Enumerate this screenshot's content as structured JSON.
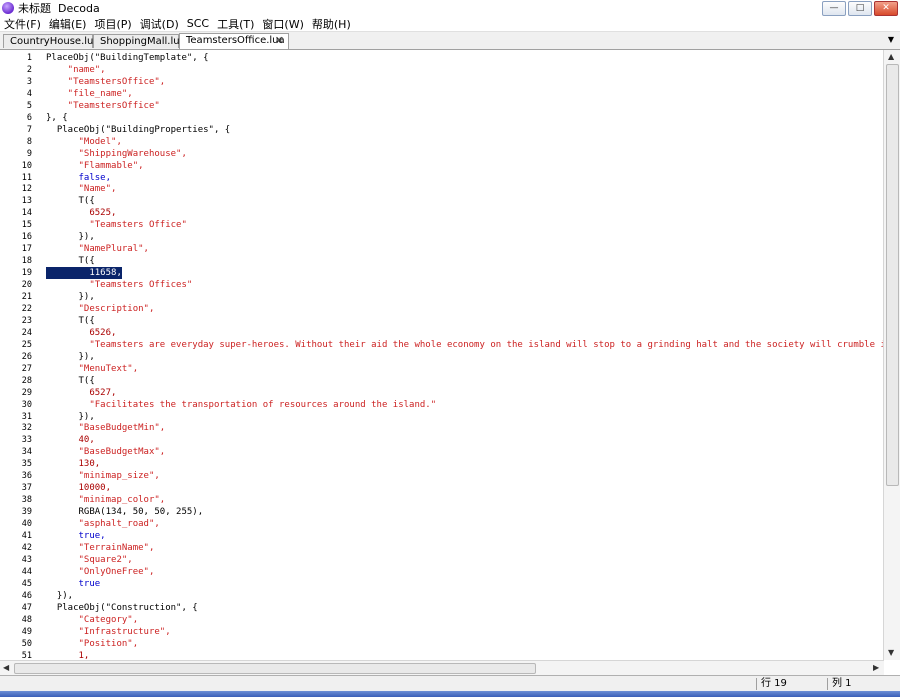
{
  "window": {
    "title": "未标题  Decoda",
    "minimize": "—",
    "maximize": "□",
    "close": "✕"
  },
  "menu": [
    "文件(F)",
    "编辑(E)",
    "项目(P)",
    "调试(D)",
    "SCC",
    "工具(T)",
    "窗口(W)",
    "帮助(H)"
  ],
  "tabs": [
    {
      "label": "CountryHouse.lua"
    },
    {
      "label": "ShoppingMall.lua"
    },
    {
      "label": "TeamstersOffice.lua"
    }
  ],
  "code_lines": [
    {
      "n": "1",
      "text": "PlaceObj(\"BuildingTemplate\", {"
    },
    {
      "n": "2",
      "text": "    \"name\","
    },
    {
      "n": "3",
      "text": "    \"TeamstersOffice\","
    },
    {
      "n": "4",
      "text": "    \"file_name\","
    },
    {
      "n": "5",
      "text": "    \"TeamstersOffice\""
    },
    {
      "n": "6",
      "text": "}, {"
    },
    {
      "n": "7",
      "text": "  PlaceObj(\"BuildingProperties\", {"
    },
    {
      "n": "8",
      "text": "      \"Model\","
    },
    {
      "n": "9",
      "text": "      \"ShippingWarehouse\","
    },
    {
      "n": "10",
      "text": "      \"Flammable\","
    },
    {
      "n": "11",
      "text": "      false,"
    },
    {
      "n": "12",
      "text": "      \"Name\","
    },
    {
      "n": "13",
      "text": "      T({"
    },
    {
      "n": "14",
      "text": "        6525,"
    },
    {
      "n": "15",
      "text": "        \"Teamsters Office\""
    },
    {
      "n": "16",
      "text": "      }),"
    },
    {
      "n": "17",
      "text": "      \"NamePlural\","
    },
    {
      "n": "18",
      "text": "      T({"
    },
    {
      "n": "19",
      "text": "        11658,"
    },
    {
      "n": "20",
      "text": "        \"Teamsters Offices\""
    },
    {
      "n": "21",
      "text": "      }),"
    },
    {
      "n": "22",
      "text": "      \"Description\","
    },
    {
      "n": "23",
      "text": "      T({"
    },
    {
      "n": "24",
      "text": "        6526,"
    },
    {
      "n": "25",
      "text": "        \"Teamsters are everyday super-heroes. Without their aid the whole economy on the island will stop to a grinding halt and the society will crumble into a dark age of"
    },
    {
      "n": "26",
      "text": "      }),"
    },
    {
      "n": "27",
      "text": "      \"MenuText\","
    },
    {
      "n": "28",
      "text": "      T({"
    },
    {
      "n": "29",
      "text": "        6527,"
    },
    {
      "n": "30",
      "text": "        \"Facilitates the transportation of resources around the island.\""
    },
    {
      "n": "31",
      "text": "      }),"
    },
    {
      "n": "32",
      "text": "      \"BaseBudgetMin\","
    },
    {
      "n": "33",
      "text": "      40,"
    },
    {
      "n": "34",
      "text": "      \"BaseBudgetMax\","
    },
    {
      "n": "35",
      "text": "      130,"
    },
    {
      "n": "36",
      "text": "      \"minimap_size\","
    },
    {
      "n": "37",
      "text": "      10000,"
    },
    {
      "n": "38",
      "text": "      \"minimap_color\","
    },
    {
      "n": "39",
      "text": "      RGBA(134, 50, 50, 255),"
    },
    {
      "n": "40",
      "text": "      \"asphalt_road\","
    },
    {
      "n": "41",
      "text": "      true,"
    },
    {
      "n": "42",
      "text": "      \"TerrainName\","
    },
    {
      "n": "43",
      "text": "      \"Square2\","
    },
    {
      "n": "44",
      "text": "      \"OnlyOneFree\","
    },
    {
      "n": "45",
      "text": "      true"
    },
    {
      "n": "46",
      "text": "  }),"
    },
    {
      "n": "47",
      "text": "  PlaceObj(\"Construction\", {"
    },
    {
      "n": "48",
      "text": "      \"Category\","
    },
    {
      "n": "49",
      "text": "      \"Infrastructure\","
    },
    {
      "n": "50",
      "text": "      \"Position\","
    },
    {
      "n": "51",
      "text": "      1,"
    }
  ],
  "selected_line": "19",
  "status": {
    "line": "行 19",
    "col": "列 1"
  },
  "colors": {
    "string": "#cc2222",
    "keyword": "#0000cc",
    "plain": "#000000",
    "selection": "#0a246a"
  }
}
